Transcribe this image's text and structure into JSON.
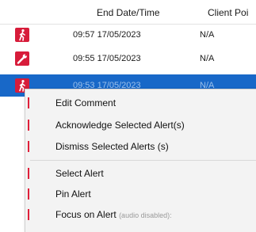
{
  "table": {
    "columns": {
      "end_datetime": "End Date/Time",
      "client_point": "Client Poi"
    },
    "rows": [
      {
        "icon": "walking-person-icon",
        "end_time": "09:57 17/05/2023",
        "client": "N/A",
        "selected": false
      },
      {
        "icon": "wrench-icon",
        "end_time": "09:55 17/05/2023",
        "client": "N/A",
        "selected": false
      },
      {
        "icon": "walking-person-icon",
        "end_time": "09:53 17/05/2023",
        "client": "N/A",
        "selected": true
      }
    ]
  },
  "context_menu": {
    "edit_comment": "Edit Comment",
    "acknowledge": "Acknowledge Selected Alert(s)",
    "dismiss": "Dismiss Selected Alerts (s)",
    "select_alert": "Select Alert",
    "pin_alert": "Pin Alert",
    "focus_alert": "Focus on Alert",
    "focus_alert_note": "(audio disabled):"
  },
  "colors": {
    "alert_red": "#d71c3a",
    "selection_blue": "#1868c8"
  }
}
